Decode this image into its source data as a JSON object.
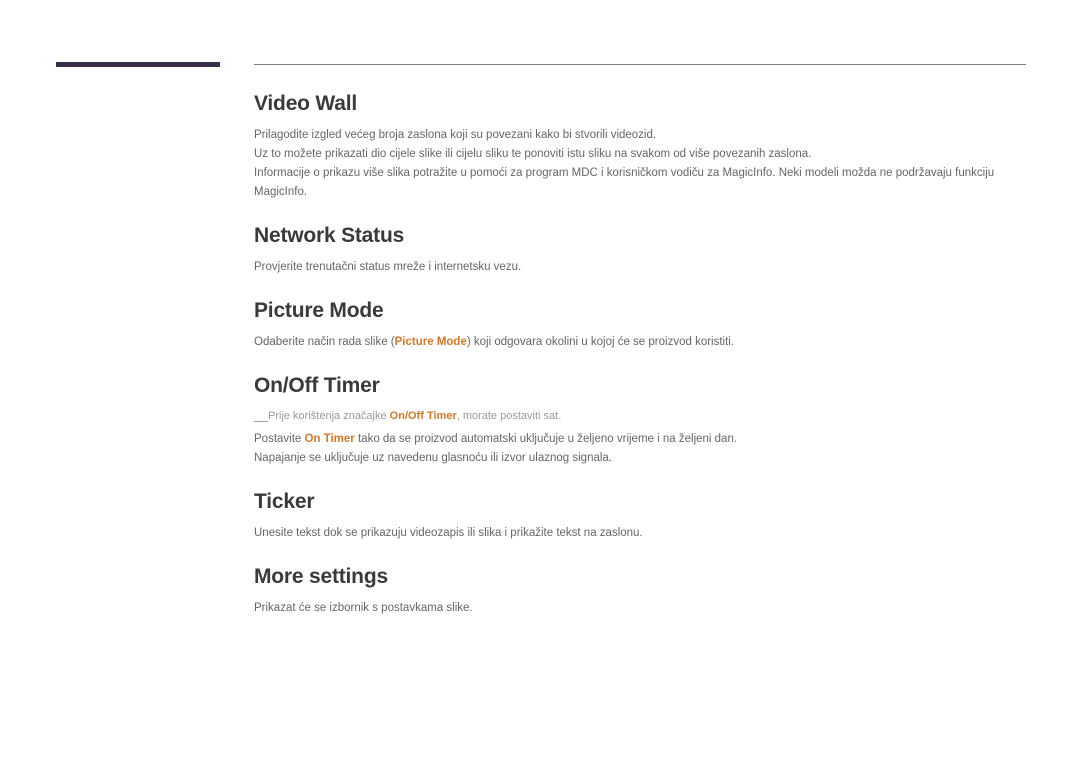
{
  "sections": {
    "videoWall": {
      "title": "Video Wall",
      "p1": "Prilagodite izgled većeg broja zaslona koji su povezani kako bi stvorili videozid.",
      "p2": "Uz to možete prikazati dio cijele slike ili cijelu sliku te ponoviti istu sliku na svakom od više povezanih zaslona.",
      "p3": "Informacije o prikazu više slika potražite u pomoći za program MDC i korisničkom vodiču za MagicInfo. Neki modeli možda ne podržavaju funkciju MagicInfo."
    },
    "networkStatus": {
      "title": "Network Status",
      "p1": "Provjerite trenutačni status mreže i internetsku vezu."
    },
    "pictureMode": {
      "title": "Picture Mode",
      "p1a": "Odaberite način rada slike (",
      "p1em": "Picture Mode",
      "p1b": ") koji odgovara okolini u kojoj će se proizvod koristiti."
    },
    "onOffTimer": {
      "title": "On/Off Timer",
      "note_a": "Prije korištenja značajke ",
      "note_em": "On/Off Timer",
      "note_b": ", morate postaviti sat.",
      "p1a": "Postavite ",
      "p1em": "On Timer",
      "p1b": " tako da se proizvod automatski uključuje u željeno vrijeme i na željeni dan.",
      "p2": "Napajanje se uključuje uz navedenu glasnoću ili izvor ulaznog signala."
    },
    "ticker": {
      "title": "Ticker",
      "p1": "Unesite tekst dok se prikazuju videozapis ili slika i prikažite tekst na zaslonu."
    },
    "moreSettings": {
      "title": "More settings",
      "p1": "Prikazat će se izbornik s postavkama slike."
    }
  }
}
